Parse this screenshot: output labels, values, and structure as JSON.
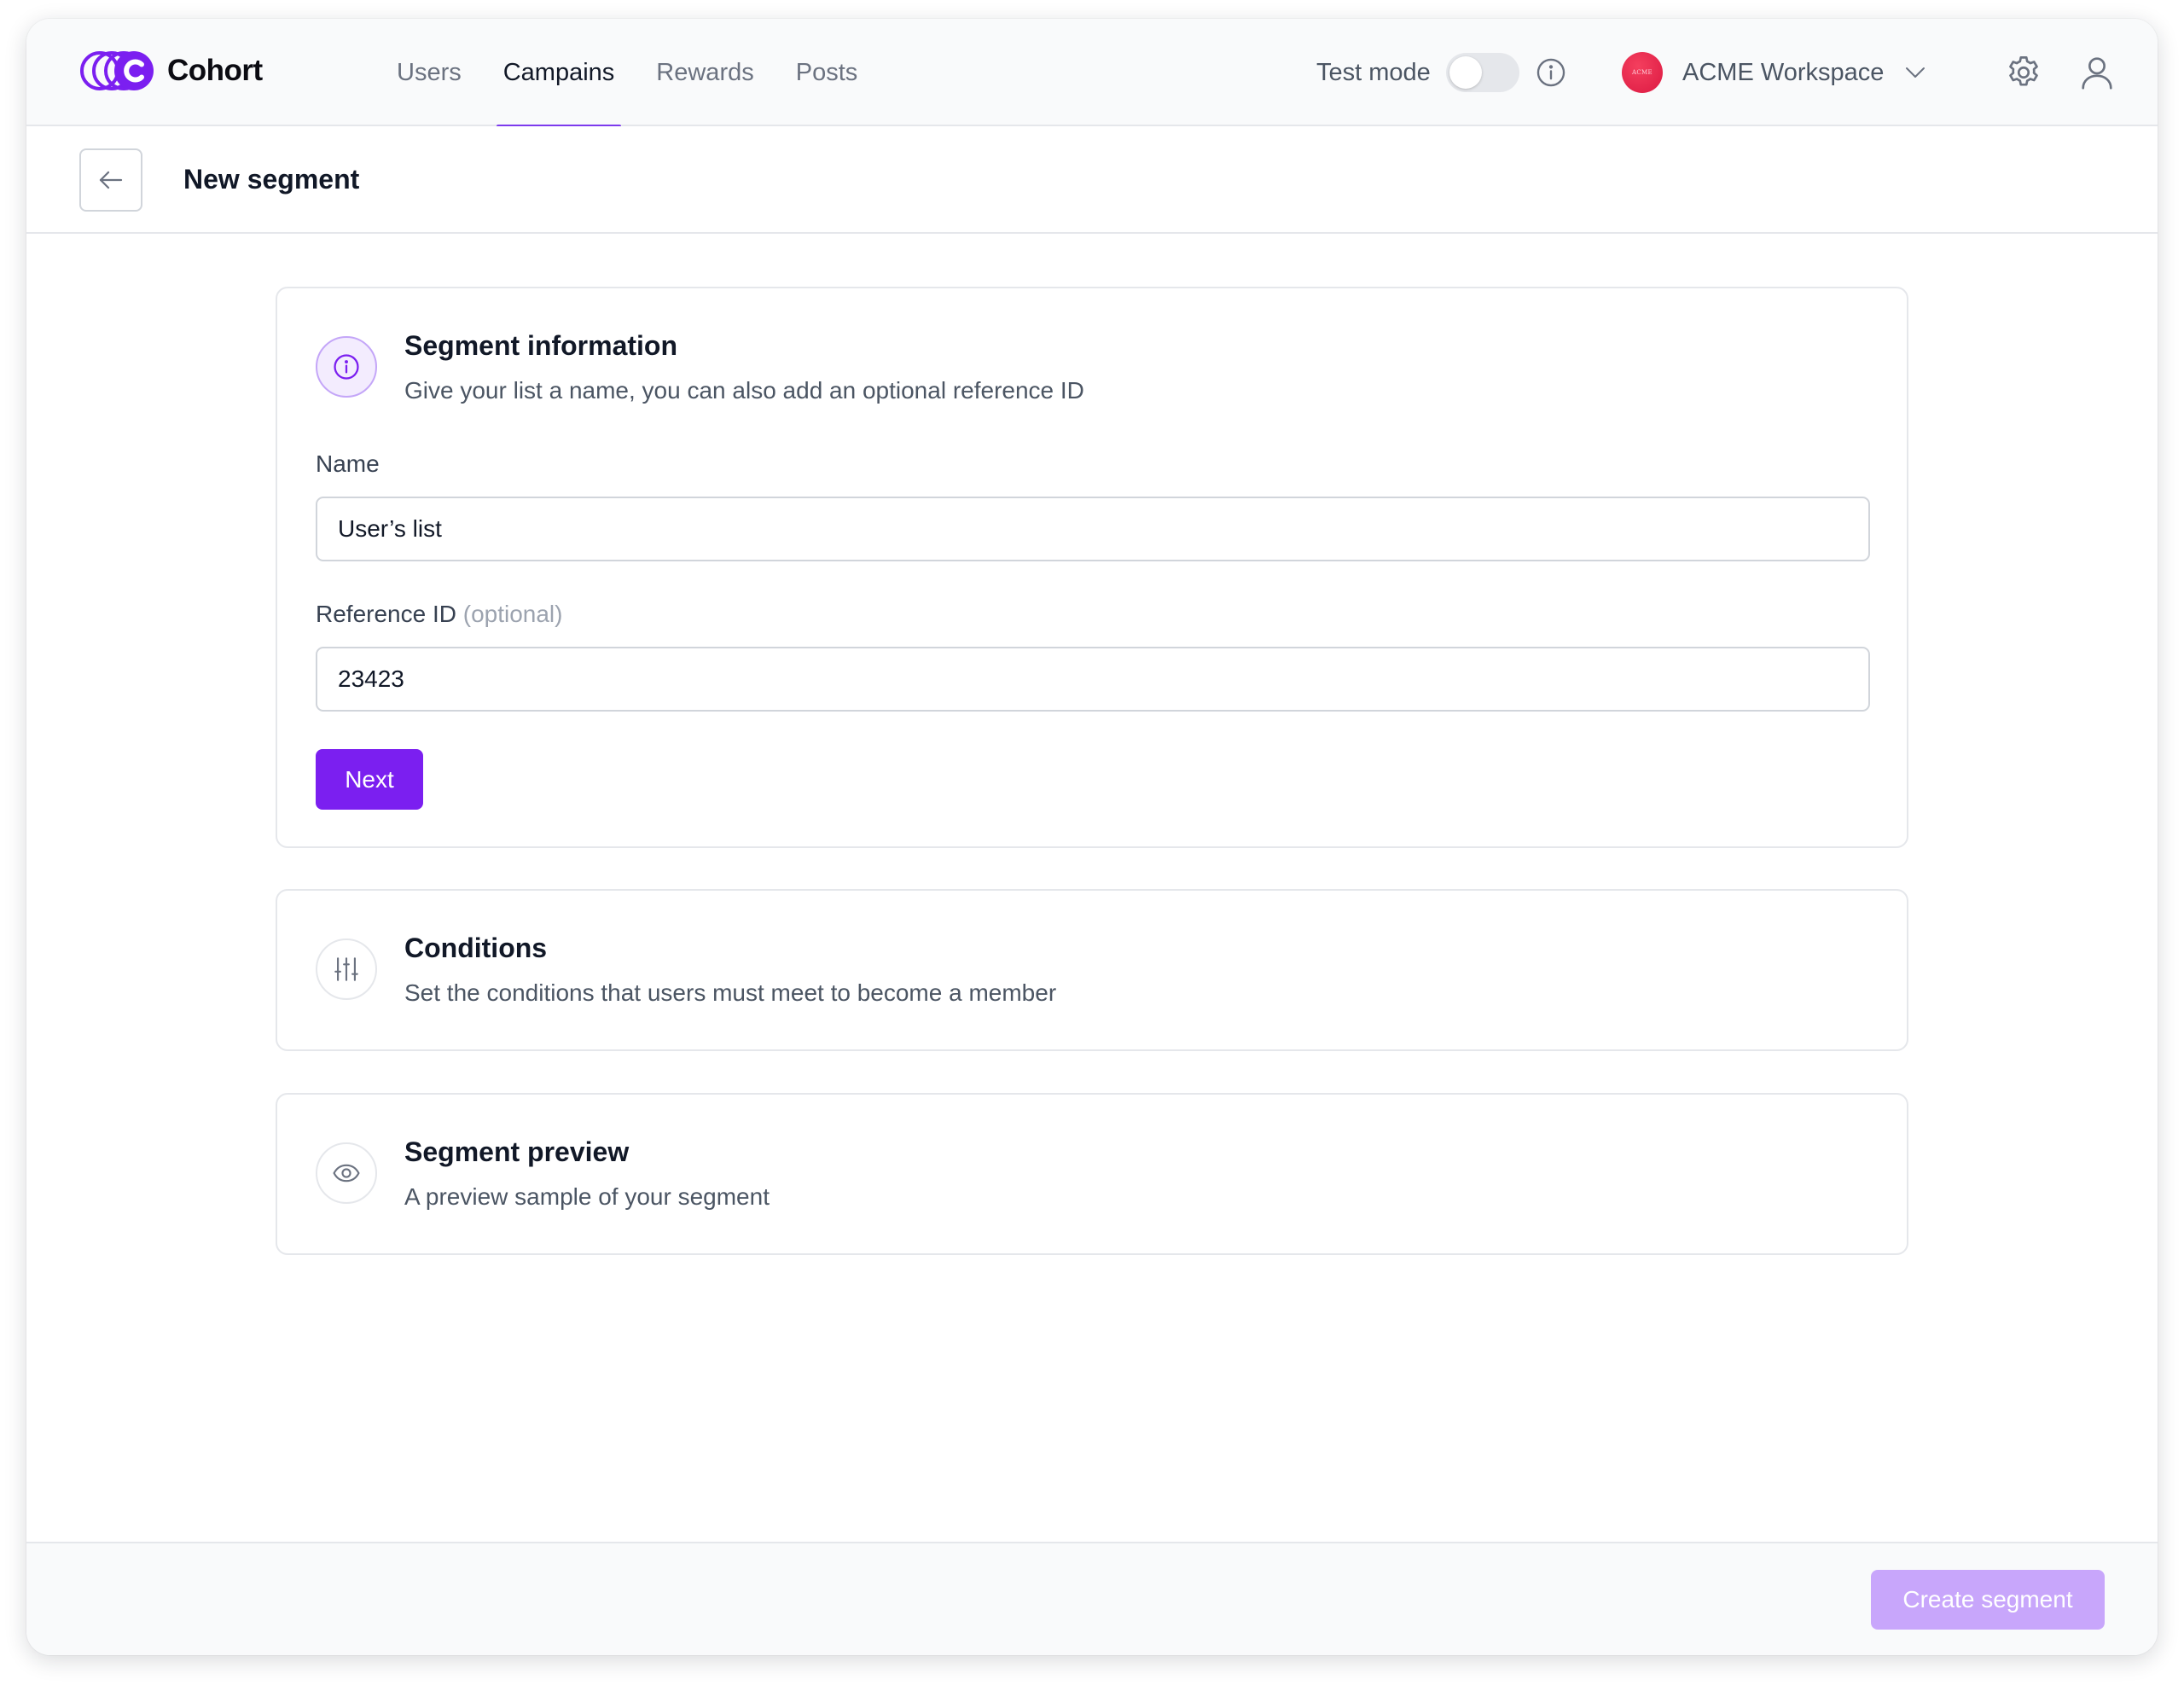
{
  "app": {
    "name": "Cohort",
    "brand_color": "#7b1ff0"
  },
  "nav": {
    "items": [
      {
        "label": "Users",
        "active": false
      },
      {
        "label": "Campains",
        "active": true
      },
      {
        "label": "Rewards",
        "active": false
      },
      {
        "label": "Posts",
        "active": false
      }
    ]
  },
  "test_mode": {
    "label": "Test mode",
    "enabled": false
  },
  "workspace": {
    "name": "ACME Workspace",
    "avatar_text": "ACME",
    "avatar_color": "#e11d48"
  },
  "header_icons": {
    "info": "info-icon",
    "settings": "gear-icon",
    "profile": "user-icon"
  },
  "page": {
    "title": "New segment"
  },
  "sections": {
    "information": {
      "title": "Segment information",
      "description": "Give your list a name, you can also add an optional reference ID",
      "icon": "info-icon",
      "name_label": "Name",
      "name_value": "User’s list",
      "ref_label": "Reference ID",
      "ref_optional": "(optional)",
      "ref_value": "23423",
      "next_label": "Next"
    },
    "conditions": {
      "title": "Conditions",
      "description": "Set the conditions that users must meet to become a member",
      "icon": "sliders-icon"
    },
    "preview": {
      "title": "Segment preview",
      "description": "A preview sample of your segment",
      "icon": "eye-icon"
    }
  },
  "footer": {
    "create_label": "Create segment",
    "create_disabled": true
  }
}
